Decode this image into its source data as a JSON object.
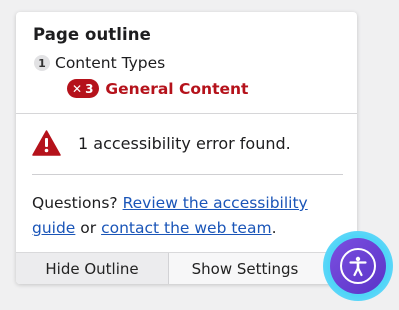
{
  "outline": {
    "title": "Page outline",
    "items": [
      {
        "level": "1",
        "label": "Content Types",
        "error": false
      },
      {
        "error_count": "3",
        "label": "General Content",
        "error": true
      }
    ]
  },
  "alert": {
    "message": "1 accessibility error found.",
    "icon": "warning-triangle-icon",
    "color": "#b5121b"
  },
  "help": {
    "prefix": "Questions? ",
    "guide_link": "Review the accessibility guide",
    "middle": " or ",
    "contact_link": "contact the web team",
    "suffix": "."
  },
  "footer": {
    "hide_outline": "Hide Outline",
    "show_settings": "Show Settings"
  },
  "a11y_toggle": {
    "icon": "accessibility-person-icon"
  }
}
